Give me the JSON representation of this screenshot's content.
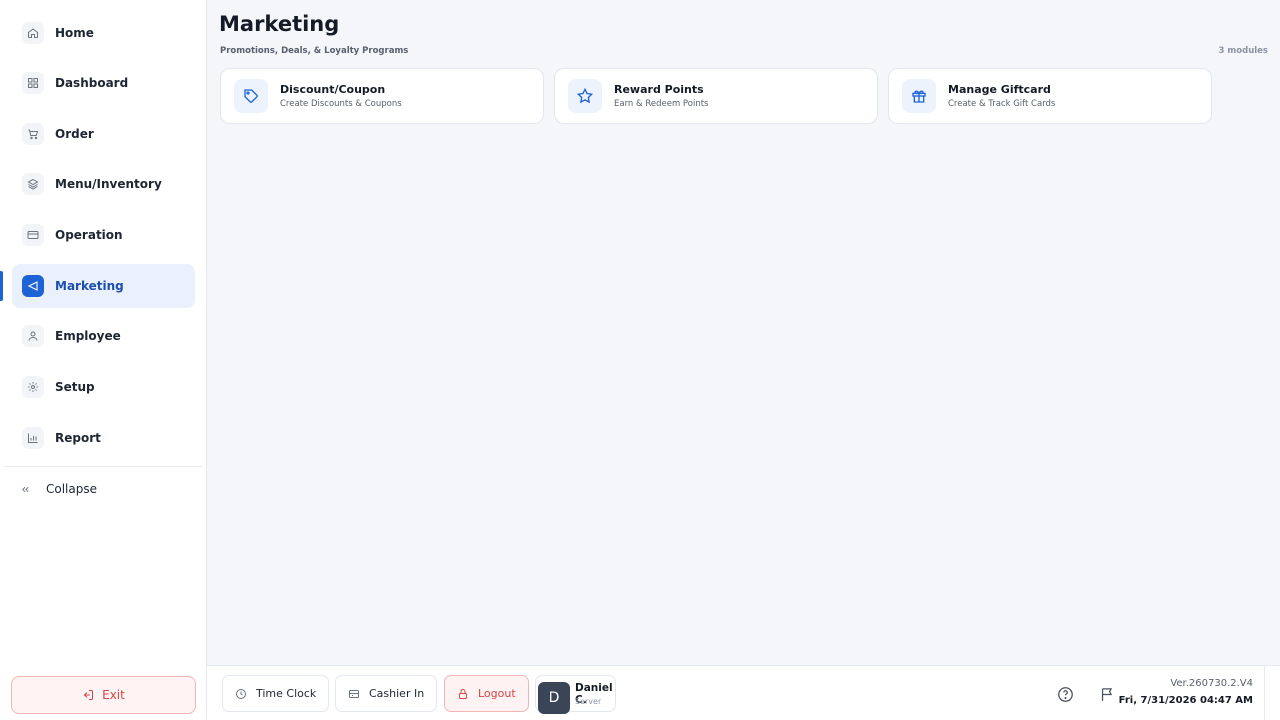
{
  "sidebar": {
    "items": [
      {
        "label": "Home",
        "icon": "home-icon"
      },
      {
        "label": "Dashboard",
        "icon": "grid-icon"
      },
      {
        "label": "Order",
        "icon": "cart-icon"
      },
      {
        "label": "Menu/Inventory",
        "icon": "layers-icon"
      },
      {
        "label": "Operation",
        "icon": "card-icon"
      },
      {
        "label": "Marketing",
        "icon": "megaphone-icon",
        "active": true
      },
      {
        "label": "Employee",
        "icon": "user-icon"
      },
      {
        "label": "Setup",
        "icon": "gear-icon"
      },
      {
        "label": "Report",
        "icon": "bar-chart-icon"
      }
    ],
    "collapse_label": "Collapse",
    "exit_label": "Exit"
  },
  "main": {
    "title": "Marketing",
    "subtitle": "Promotions, Deals, & Loyalty Programs",
    "module_count": "3 modules",
    "cards": [
      {
        "title": "Discount/Coupon",
        "subtitle": "Create Discounts & Coupons",
        "icon": "tag-icon"
      },
      {
        "title": "Reward Points",
        "subtitle": "Earn & Redeem Points",
        "icon": "star-icon"
      },
      {
        "title": "Manage Giftcard",
        "subtitle": "Create & Track Gift Cards",
        "icon": "gift-icon"
      }
    ]
  },
  "footer": {
    "time_clock_label": "Time Clock",
    "cashier_in_label": "Cashier In",
    "logout_label": "Logout",
    "user": {
      "initial": "D",
      "name": "Daniel C.",
      "role": "Server"
    },
    "version": "Ver.260730.2.V4",
    "datetime": "Fri, 7/31/2026 04:47 AM"
  },
  "colors": {
    "accent": "#1d63d6",
    "danger": "#d64545",
    "background": "#f5f6fa"
  }
}
